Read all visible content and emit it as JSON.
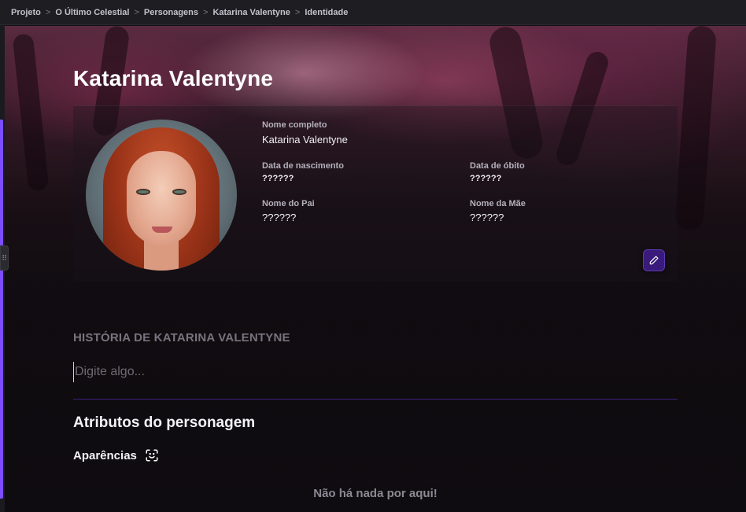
{
  "breadcrumb": {
    "items": [
      "Projeto",
      "O Último Celestial",
      "Personagens",
      "Katarina Valentyne",
      "Identidade"
    ],
    "separator": ">"
  },
  "character": {
    "name": "Katarina Valentyne",
    "fields": {
      "full_name_label": "Nome completo",
      "full_name_value": "Katarina Valentyne",
      "birth_label": "Data de nascimento",
      "birth_value": "??????",
      "death_label": "Data de óbito",
      "death_value": "??????",
      "father_label": "Nome do Pai",
      "father_value": "??????",
      "mother_label": "Nome da Mãe",
      "mother_value": "??????"
    }
  },
  "story": {
    "heading": "HISTÓRIA DE KATARINA VALENTYNE",
    "placeholder": "Digite algo..."
  },
  "attributes": {
    "title": "Atributos do personagem",
    "appearance_label": "Aparências",
    "appearance_icon": "face-scan-icon",
    "empty_text": "Não há nada por aqui!"
  },
  "icons": {
    "edit": "pencil-icon",
    "resize": "drag-handle-icon"
  },
  "colors": {
    "accent": "#7c4dff",
    "edit_button": "#3a1a7a",
    "divider": "#3a1f7a"
  }
}
